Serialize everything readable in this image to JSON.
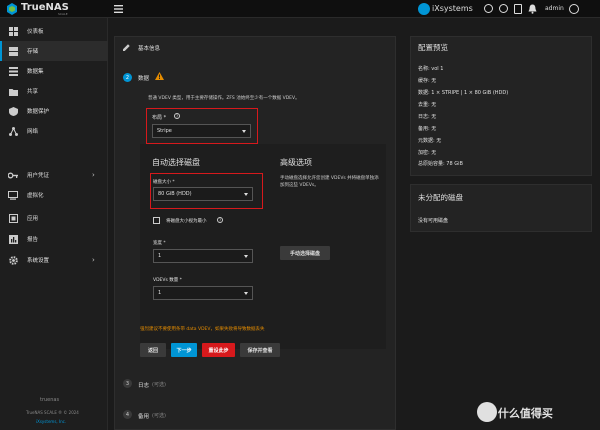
{
  "header": {
    "logo": "TrueNAS",
    "logo_sub": "SCALE",
    "brand": "iXsystems",
    "user": "admin"
  },
  "sidebar": {
    "items": [
      {
        "label": "仪表板",
        "icon": "dashboard-icon"
      },
      {
        "label": "存储",
        "icon": "storage-icon"
      },
      {
        "label": "数据集",
        "icon": "datasets-icon"
      },
      {
        "label": "共享",
        "icon": "shares-icon"
      },
      {
        "label": "数据保护",
        "icon": "data-protection-icon"
      },
      {
        "label": "网络",
        "icon": "network-icon"
      },
      {
        "label": "用户凭证",
        "icon": "credentials-icon"
      },
      {
        "label": "虚拟化",
        "icon": "virtualization-icon"
      },
      {
        "label": "应用",
        "icon": "apps-icon"
      },
      {
        "label": "报告",
        "icon": "reports-icon"
      },
      {
        "label": "系统设置",
        "icon": "system-settings-icon"
      }
    ],
    "footer": {
      "hostname": "truenas",
      "version": "TrueNAS SCALE ® © 2024",
      "company": "iXsystems, Inc."
    }
  },
  "wizard": {
    "basic_info": "基本信息",
    "step2_num": "2",
    "step2_title": "数据",
    "desc": "普通 VDEV 类型，用于主要存储操作。ZFS 池始终至少有一个数据 VDEV。",
    "layout_label": "布局 *",
    "layout_value": "Stripe",
    "auto_title": "自动选择磁盘",
    "disk_size_label": "磁盘大小 *",
    "disk_size_value": "80 GiB (HDD)",
    "treat_label": "将磁盘大小视为最小",
    "width_label": "宽度 *",
    "width_value": "1",
    "vdev_label": "VDEVs 数量 *",
    "vdev_value": "1",
    "adv_title": "高级选项",
    "adv_desc": "手动磁盘选择允许您创建 VDEVs 并将磁盘单独添加到这些 VDEVs。",
    "manual_btn": "手动选择磁盘",
    "warning": "强烈建议不要使用条带 data VDEV，如果失败将导致数据丢失",
    "back_btn": "返回",
    "next_btn": "下一步",
    "reset_btn": "重设此步",
    "save_btn": "保存并查看",
    "step3_num": "3",
    "step3_title": "日志",
    "step3_opt": "(可选)",
    "step4_num": "4",
    "step4_title": "备用",
    "step4_opt": "(可选)"
  },
  "preview": {
    "title": "配置预览",
    "lines": [
      "名称: vol 1",
      "缓存: 无",
      "数据: 1 × STRIPE | 1 × 80 GiB (HDD)",
      "去重: 无",
      "日志: 无",
      "备用: 无",
      "元数据: 无",
      "加密: 无",
      "总原始容量: 78 GiB"
    ],
    "unassigned_title": "未分配的磁盘",
    "unassigned_text": "没有可用磁盘"
  },
  "watermark": "值 什么值得买",
  "colors": {
    "accent": "#0095d5",
    "danger": "#d7191c",
    "warning": "#e68d00"
  }
}
